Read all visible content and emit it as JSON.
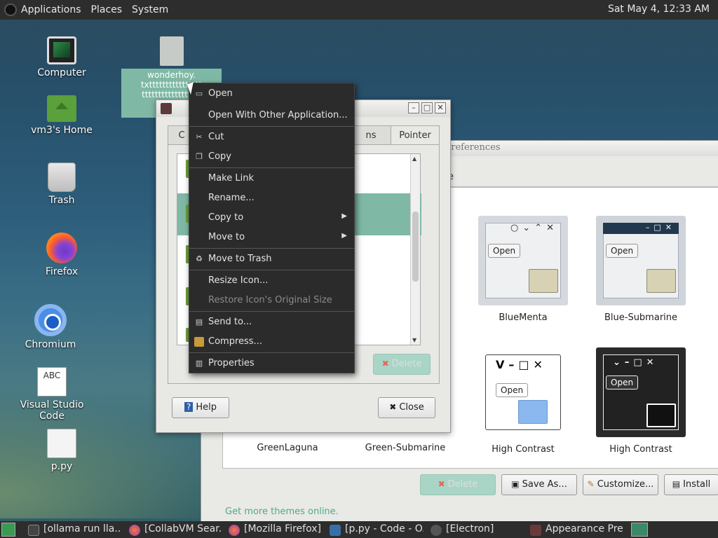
{
  "top_panel": {
    "menus": [
      "Applications",
      "Places",
      "System"
    ],
    "clock": "Sat May  4, 12:33 AM"
  },
  "desktop_icons": [
    {
      "label": "Computer",
      "icon": "computer-icon"
    },
    {
      "label": "vm3's Home",
      "icon": "home-folder-icon"
    },
    {
      "label": "Trash",
      "icon": "trash-icon"
    },
    {
      "label": "Firefox",
      "icon": "firefox-icon"
    },
    {
      "label": "Chromium",
      "icon": "chromium-icon"
    },
    {
      "label": "Visual Studio Code",
      "icon": "abc-text-icon"
    },
    {
      "label": "p.py",
      "icon": "file-icon"
    }
  ],
  "selected_file": {
    "label": "wonderhoy.\ntxtttttttttttttttt\ntttttttttttttttttt"
  },
  "context_menu": {
    "items": [
      {
        "label": "Open",
        "icon": "open-icon",
        "enabled": true
      },
      {
        "label": "Open With Other Application...",
        "enabled": true
      },
      {
        "label": "Cut",
        "icon": "cut-icon",
        "enabled": true
      },
      {
        "label": "Copy",
        "icon": "copy-icon",
        "enabled": true
      },
      {
        "label": "Make Link",
        "enabled": true
      },
      {
        "label": "Rename...",
        "enabled": true
      },
      {
        "label": "Copy to",
        "submenu": true,
        "enabled": true
      },
      {
        "label": "Move to",
        "submenu": true,
        "enabled": true
      },
      {
        "label": "Move to Trash",
        "icon": "trash-icon",
        "enabled": true
      },
      {
        "label": "Resize Icon...",
        "enabled": true
      },
      {
        "label": "Restore Icon's Original Size",
        "enabled": false
      },
      {
        "label": "Send to...",
        "icon": "send-icon",
        "enabled": true
      },
      {
        "label": "Compress...",
        "icon": "archive-icon",
        "enabled": true
      },
      {
        "label": "Properties",
        "icon": "properties-icon",
        "enabled": true
      }
    ]
  },
  "pointer_dialog": {
    "tabs": [
      "C",
      "ns",
      "Pointer"
    ],
    "delete_label": "Delete",
    "help_label": "Help",
    "close_label": "Close"
  },
  "appearance_window": {
    "title": "nce Preferences",
    "tab_fragment": "e",
    "themes": [
      {
        "name": "BlueMenta"
      },
      {
        "name": "Blue-Submarine"
      },
      {
        "name": "High Contrast"
      },
      {
        "name": "High Contrast"
      },
      {
        "name": "GreenLaguna"
      },
      {
        "name": "Green-Submarine"
      }
    ],
    "thumb_open_label": "Open",
    "buttons": {
      "delete": "Delete",
      "save_as": "Save As...",
      "customize": "Customize...",
      "install": "Install"
    },
    "get_more": "Get more themes online."
  },
  "taskbar": {
    "tasks": [
      {
        "label": "[ollama run lla...",
        "icon": "terminal-icon"
      },
      {
        "label": "[CollabVM Sear...",
        "icon": "firefox-icon"
      },
      {
        "label": "[Mozilla Firefox]",
        "icon": "firefox-icon"
      },
      {
        "label": "[p.py - Code - O...",
        "icon": "vscode-icon"
      },
      {
        "label": "[Electron]",
        "icon": "electron-icon"
      },
      {
        "label": "Appearance Pre...",
        "icon": "appearance-icon"
      }
    ]
  }
}
